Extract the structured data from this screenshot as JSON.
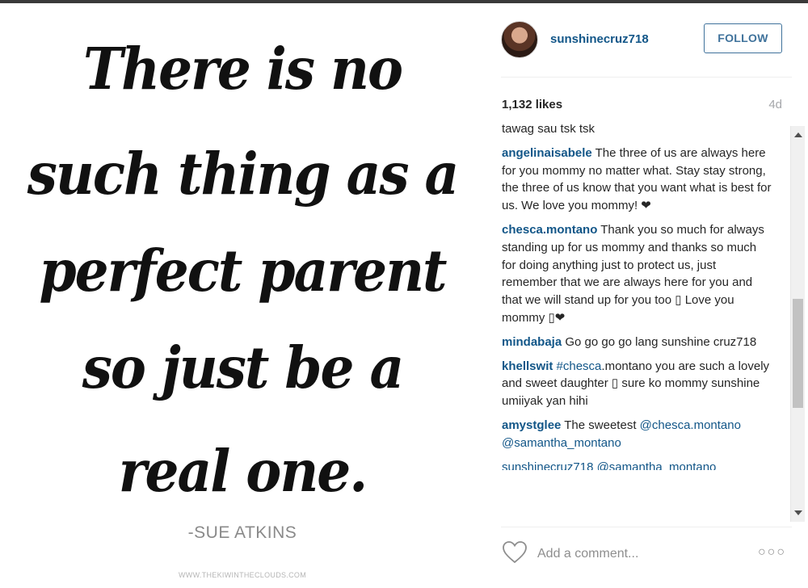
{
  "photo": {
    "quote_lines": [
      "There is no",
      "such thing as a",
      "perfect parent",
      "so just be a",
      "real one."
    ],
    "attribution": "-SUE ATKINS",
    "watermark": "WWW.THEKIWINTHECLOUDS.COM"
  },
  "header": {
    "username": "sunshinecruz718",
    "follow_label": "FOLLOW"
  },
  "stats": {
    "likes": "1,132 likes",
    "age": "4d"
  },
  "comments": [
    {
      "author": "",
      "text": "tawag sau tsk tsk"
    },
    {
      "author": "angelinaisabele",
      "text": " The three of us are always here for you mommy no matter what. Stay stay strong, the three of us know that you want what is best for us. We love you mommy! ❤"
    },
    {
      "author": "chesca.montano",
      "text": " Thank you so much for always standing up for us mommy and thanks so much for doing anything just to protect us, just remember that we are always here for you and that we will stand up for you too ▯ Love you mommy ▯❤"
    },
    {
      "author": "mindabaja",
      "text": " Go go go go lang sunshine cruz718"
    },
    {
      "author": "khellswit",
      "mention": " #chesca",
      "text": ".montano you are such a lovely and sweet daughter ▯ sure ko mommy sunshine umiiyak yan hihi"
    },
    {
      "author": "amystglee",
      "text": " The sweetest ",
      "mention2": "@chesca.montano @samantha_montano"
    },
    {
      "author": "",
      "text": "sunshinecruz718 @samantha_montano"
    }
  ],
  "footer": {
    "comment_placeholder": "Add a comment...",
    "more_glyph": "○○○"
  }
}
